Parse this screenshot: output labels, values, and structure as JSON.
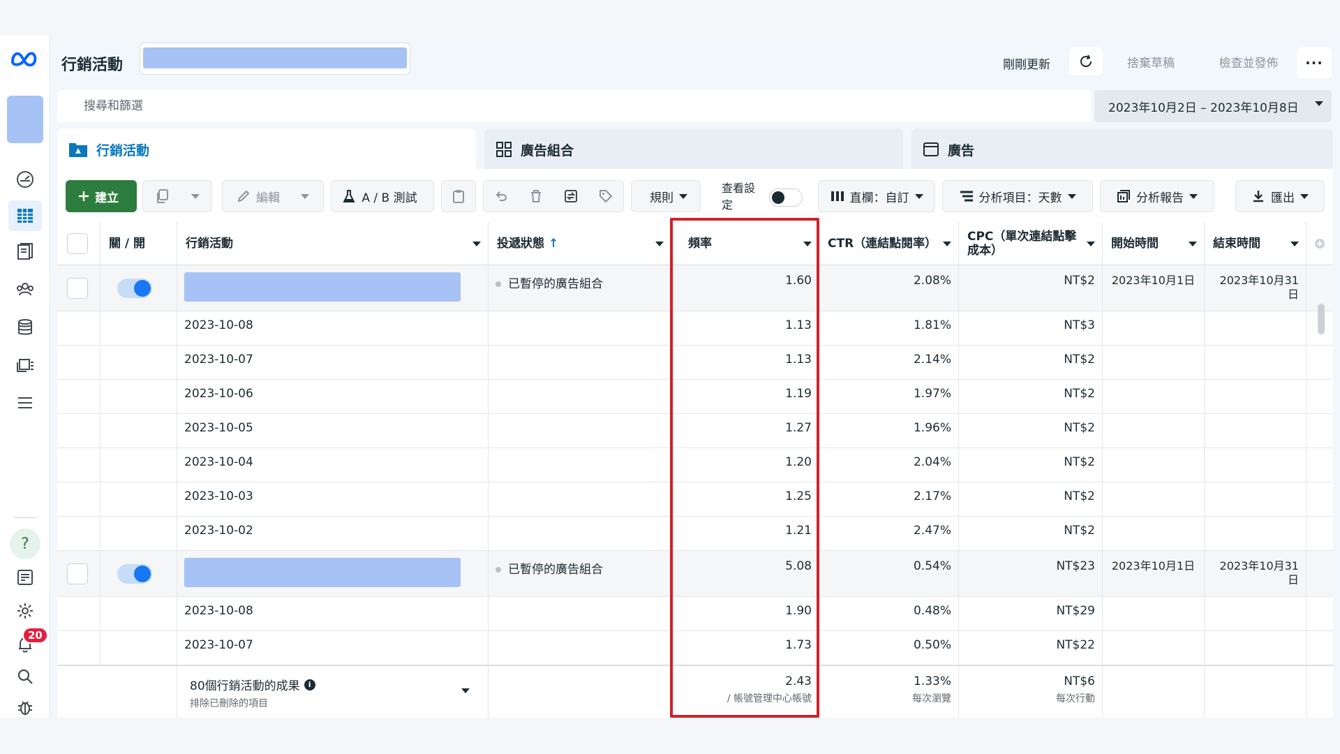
{
  "header": {
    "title": "行銷活動",
    "refresh_status": "剛剛更新",
    "discard_label": "捨棄草稿",
    "review_label": "檢查並發佈",
    "more_label": "···"
  },
  "search": {
    "placeholder": "搜尋和篩選",
    "date_range": "2023年10月2日 – 2023年10月8日"
  },
  "tabs": [
    {
      "label": "行銷活動",
      "active": true
    },
    {
      "label": "廣告組合",
      "active": false
    },
    {
      "label": "廣告",
      "active": false
    }
  ],
  "toolbar": {
    "create_label": "建立",
    "edit_label": "編輯",
    "ab_test_label": "A / B 測試",
    "rules_label": "規則",
    "view_setting_label": "查看設定",
    "columns_label": "直欄：自訂",
    "breakdown_label": "分析項目：天數",
    "reports_label": "分析報告",
    "export_label": "匯出"
  },
  "table": {
    "columns": {
      "toggle": "關 / 開",
      "campaign": "行銷活動",
      "delivery": "投遞狀態",
      "delivery_sort_arrow": "↑",
      "frequency": "頻率",
      "ctr": "CTR（連結點閱率）",
      "cpc": "CPC（單次連結點擊成本）",
      "start": "開始時間",
      "end": "結束時間"
    },
    "rows": [
      {
        "parent": true,
        "name": "",
        "delivery": "已暫停的廣告組合",
        "frequency": "1.60",
        "ctr": "2.08%",
        "cpc": "NT$2",
        "start": "2023年10月1日",
        "end": "2023年10月31日"
      },
      {
        "parent": false,
        "name": "2023-10-08",
        "delivery": "",
        "frequency": "1.13",
        "ctr": "1.81%",
        "cpc": "NT$3",
        "start": "",
        "end": ""
      },
      {
        "parent": false,
        "name": "2023-10-07",
        "delivery": "",
        "frequency": "1.13",
        "ctr": "2.14%",
        "cpc": "NT$2",
        "start": "",
        "end": ""
      },
      {
        "parent": false,
        "name": "2023-10-06",
        "delivery": "",
        "frequency": "1.19",
        "ctr": "1.97%",
        "cpc": "NT$2",
        "start": "",
        "end": ""
      },
      {
        "parent": false,
        "name": "2023-10-05",
        "delivery": "",
        "frequency": "1.27",
        "ctr": "1.96%",
        "cpc": "NT$2",
        "start": "",
        "end": ""
      },
      {
        "parent": false,
        "name": "2023-10-04",
        "delivery": "",
        "frequency": "1.20",
        "ctr": "2.04%",
        "cpc": "NT$2",
        "start": "",
        "end": ""
      },
      {
        "parent": false,
        "name": "2023-10-03",
        "delivery": "",
        "frequency": "1.25",
        "ctr": "2.17%",
        "cpc": "NT$2",
        "start": "",
        "end": ""
      },
      {
        "parent": false,
        "name": "2023-10-02",
        "delivery": "",
        "frequency": "1.21",
        "ctr": "2.47%",
        "cpc": "NT$2",
        "start": "",
        "end": ""
      },
      {
        "parent": true,
        "name": "",
        "delivery": "已暫停的廣告組合",
        "frequency": "5.08",
        "ctr": "0.54%",
        "cpc": "NT$23",
        "start": "2023年10月1日",
        "end": "2023年10月31日"
      },
      {
        "parent": false,
        "name": "2023-10-08",
        "delivery": "",
        "frequency": "1.90",
        "ctr": "0.48%",
        "cpc": "NT$29",
        "start": "",
        "end": ""
      },
      {
        "parent": false,
        "name": "2023-10-07",
        "delivery": "",
        "frequency": "1.73",
        "ctr": "0.50%",
        "cpc": "NT$22",
        "start": "",
        "end": ""
      }
    ],
    "footer": {
      "results_title": "80個行銷活動的成果",
      "results_sub": "排除已刪除的項目",
      "frequency": "2.43",
      "frequency_sub": "/ 帳號管理中心帳號",
      "ctr": "1.33%",
      "ctr_sub": "每次瀏覽",
      "cpc": "NT$6",
      "cpc_sub": "每次行動"
    }
  },
  "nav": {
    "notification_count": "20",
    "help_label": "?"
  },
  "colors": {
    "accent": "#0a78be",
    "create_button": "#2d7e3e",
    "highlight": "#d1212a",
    "placeholder_fill": "#a7c3f5"
  }
}
